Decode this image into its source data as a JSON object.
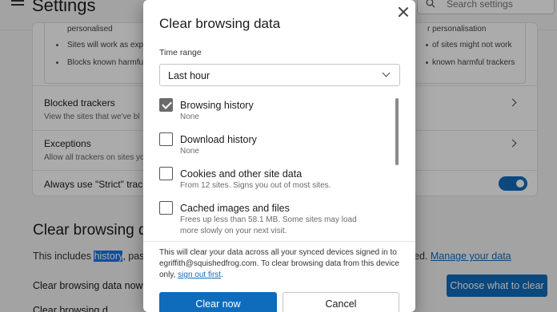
{
  "header": {
    "title": "Settings",
    "search_placeholder": "Search settings"
  },
  "tracking_card": {
    "left_bullets": [
      "personalised",
      "Sites will work as exp",
      "Blocks known harmful"
    ],
    "right_bullets": [
      "r personalisation",
      "of sites might not work",
      "known harmful trackers"
    ],
    "blocked_trackers": {
      "title": "Blocked trackers",
      "subtitle": "View the sites that we've bl"
    },
    "exceptions": {
      "title": "Exceptions",
      "subtitle": "Allow all trackers on sites yo"
    },
    "strict_inprivate": {
      "title": "Always use \"Strict\" trac",
      "enabled": true
    }
  },
  "clear_section": {
    "heading": "Clear browsing da",
    "para_start": "This includes ",
    "para_highlight": "history",
    "para_rest": ", pass",
    "para_right": "ed.",
    "manage_link": "Manage your data",
    "clear_now_label": "Clear browsing data now",
    "choose_button": "Choose what to clear",
    "clear_on_close": "Clear browsing d"
  },
  "dialog": {
    "title": "Clear browsing data",
    "time_range_label": "Time range",
    "time_range_value": "Last hour",
    "options": [
      {
        "title": "Browsing history",
        "subtitle": "None",
        "checked": true
      },
      {
        "title": "Download history",
        "subtitle": "None",
        "checked": false
      },
      {
        "title": "Cookies and other site data",
        "subtitle": "From 12 sites. Signs you out of most sites.",
        "checked": false
      },
      {
        "title": "Cached images and files",
        "subtitle": "Frees up less than 58.1 MB. Some sites may load more slowly on your next visit.",
        "checked": false
      }
    ],
    "info_text_1": "This will clear your data across all your synced devices signed in to egriffith@squishedfrog.com. To clear browsing data from this device only, ",
    "info_link": "sign out first",
    "info_text_2": ".",
    "clear_button": "Clear now",
    "cancel_button": "Cancel"
  },
  "colors": {
    "accent": "#0f6cbd",
    "highlight": "#1a73e8"
  }
}
